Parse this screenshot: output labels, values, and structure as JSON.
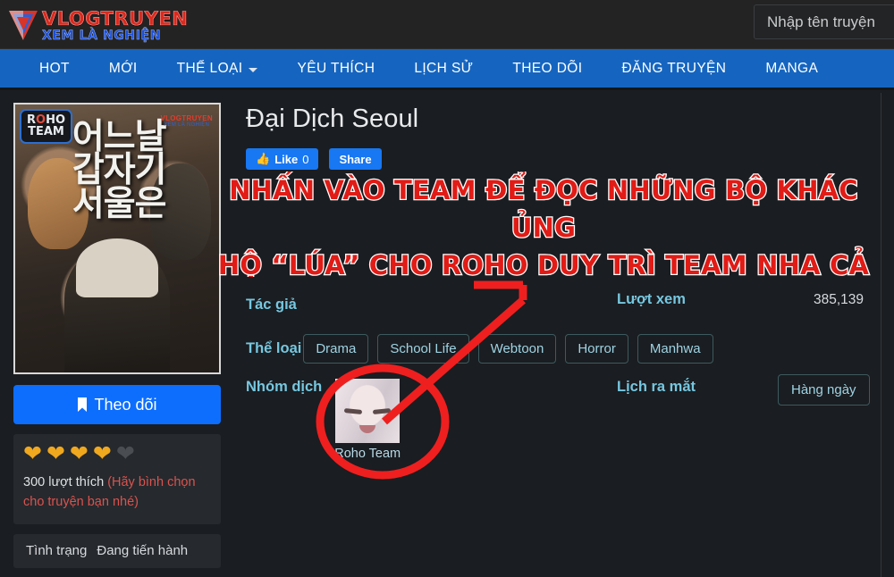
{
  "site": {
    "logo_top": "VLOGTRUYEN",
    "logo_sub": "XEM LÀ NGHIỆN",
    "search_placeholder": "Nhập tên truyện",
    "search_value": ""
  },
  "nav": {
    "items": [
      {
        "label": "HOT",
        "caret": false
      },
      {
        "label": "MỚI",
        "caret": false
      },
      {
        "label": "THỂ LOẠI",
        "caret": true
      },
      {
        "label": "YÊU THÍCH",
        "caret": false
      },
      {
        "label": "LỊCH SỬ",
        "caret": false
      },
      {
        "label": "THEO DÕI",
        "caret": false
      },
      {
        "label": "ĐĂNG TRUYỆN",
        "caret": false
      },
      {
        "label": "MANGA",
        "caret": false
      }
    ]
  },
  "comic": {
    "title": "Đại Dịch Seoul",
    "cover_korean_title": "어느날\n갑자기\n서울은",
    "cover_team_badge": "ROHO\nTEAM",
    "cover_watermark_top": "VLOGTRUYEN",
    "cover_watermark_sub": "XEM LÀ NGHIỆN"
  },
  "social": {
    "like_label": "Like",
    "like_count": "0",
    "share_label": "Share",
    "thumb_icon": "thumbs-up-icon"
  },
  "banner": {
    "line1": "NHẤN VÀO TEAM ĐỂ ĐỌC NHỮNG BỘ KHÁC ỦNG",
    "line2": "HỘ “LÚA” CHO ROHO DUY TRÌ TEAM NHA CẢ NHÀ!!",
    "color": "#e11b16",
    "outline": "#ffffff"
  },
  "sidebar": {
    "follow_label": "Theo dõi",
    "follow_icon": "bookmark-icon",
    "follow_color": "#0d6efd",
    "rating": {
      "filled": 4,
      "total": 5,
      "on_color": "#f0a81e",
      "off_color": "#4a4e52"
    },
    "likes_text": "300 lượt thích",
    "likes_note": "(Hãy bình chọn cho truyện bạn nhé)",
    "status_label": "Tình trạng",
    "status_value": "Đang tiến hành"
  },
  "info": {
    "author_label": "Tác giả",
    "author_value": "",
    "views_label": "Lượt xem",
    "views_value": "385,139",
    "genre_label": "Thể loại",
    "genres": [
      "Drama",
      "School Life",
      "Webtoon",
      "Horror",
      "Manhwa"
    ],
    "group_label": "Nhóm dịch",
    "group_name": "Roho Team",
    "schedule_label": "Lịch ra mắt",
    "schedule_value": "Hàng ngày"
  },
  "annotations": {
    "circle_color": "#ef1f1f",
    "arrow_color": "#ef1f1f"
  }
}
